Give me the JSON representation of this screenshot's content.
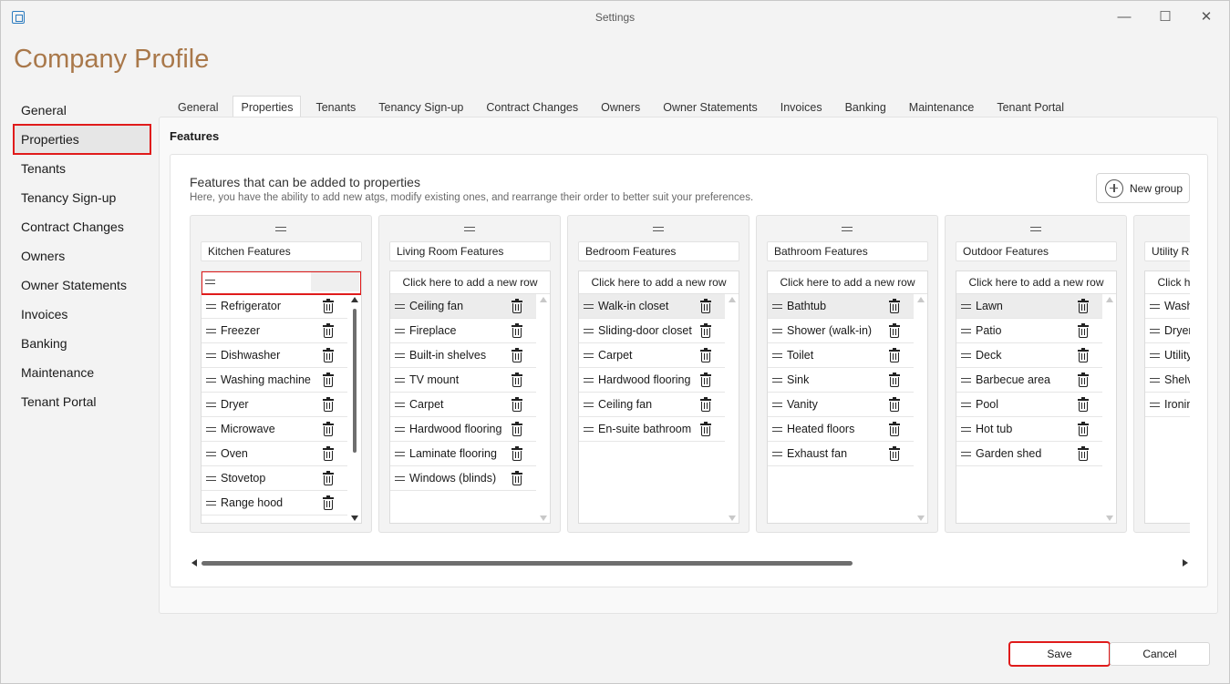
{
  "window": {
    "title": "Settings",
    "minimize": "—",
    "maximize": "☐",
    "close": "✕"
  },
  "page_title": "Company Profile",
  "nav": {
    "items": [
      "General",
      "Properties",
      "Tenants",
      "Tenancy Sign-up",
      "Contract Changes",
      "Owners",
      "Owner Statements",
      "Invoices",
      "Banking",
      "Maintenance",
      "Tenant Portal"
    ],
    "active": "Properties"
  },
  "tabs": {
    "items": [
      "General",
      "Properties",
      "Tenants",
      "Tenancy Sign-up",
      "Contract Changes",
      "Owners",
      "Owner Statements",
      "Invoices",
      "Banking",
      "Maintenance",
      "Tenant Portal"
    ],
    "active": "Properties"
  },
  "section_title": "Features",
  "features": {
    "title": "Features that can be added to properties",
    "subtitle": "Here, you have the ability to add new atgs, modify existing ones, and rearrange their order to better suit your preferences.",
    "new_group_label": "New group",
    "add_row_text": "Click here to add a new row"
  },
  "groups": [
    {
      "name": "Kitchen Features",
      "editing": true,
      "selected_index": -1,
      "items": [
        "Refrigerator",
        "Freezer",
        "Dishwasher",
        "Washing machine",
        "Dryer",
        "Microwave",
        "Oven",
        "Stovetop",
        "Range hood"
      ]
    },
    {
      "name": "Living Room Features",
      "editing": false,
      "selected_index": 0,
      "items": [
        "Ceiling fan",
        "Fireplace",
        "Built-in shelves",
        "TV mount",
        "Carpet",
        "Hardwood flooring",
        "Laminate flooring",
        "Windows (blinds)"
      ]
    },
    {
      "name": "Bedroom Features",
      "editing": false,
      "selected_index": 0,
      "items": [
        "Walk-in closet",
        "Sliding-door closet",
        "Carpet",
        "Hardwood flooring",
        "Ceiling fan",
        "En-suite bathroom"
      ]
    },
    {
      "name": "Bathroom Features",
      "editing": false,
      "selected_index": 0,
      "items": [
        "Bathtub",
        "Shower (walk-in)",
        "Toilet",
        "Sink",
        "Vanity",
        "Heated floors",
        "Exhaust fan"
      ]
    },
    {
      "name": "Outdoor Features",
      "editing": false,
      "selected_index": 0,
      "items": [
        "Lawn",
        "Patio",
        "Deck",
        "Barbecue area",
        "Pool",
        "Hot tub",
        "Garden shed"
      ]
    },
    {
      "name": "Utility Room Features",
      "editing": false,
      "selected_index": -1,
      "items": [
        "Washer",
        "Dryer",
        "Utility sink",
        "Shelves",
        "Ironing board"
      ]
    }
  ],
  "footer": {
    "save_label": "Save",
    "cancel_label": "Cancel"
  }
}
